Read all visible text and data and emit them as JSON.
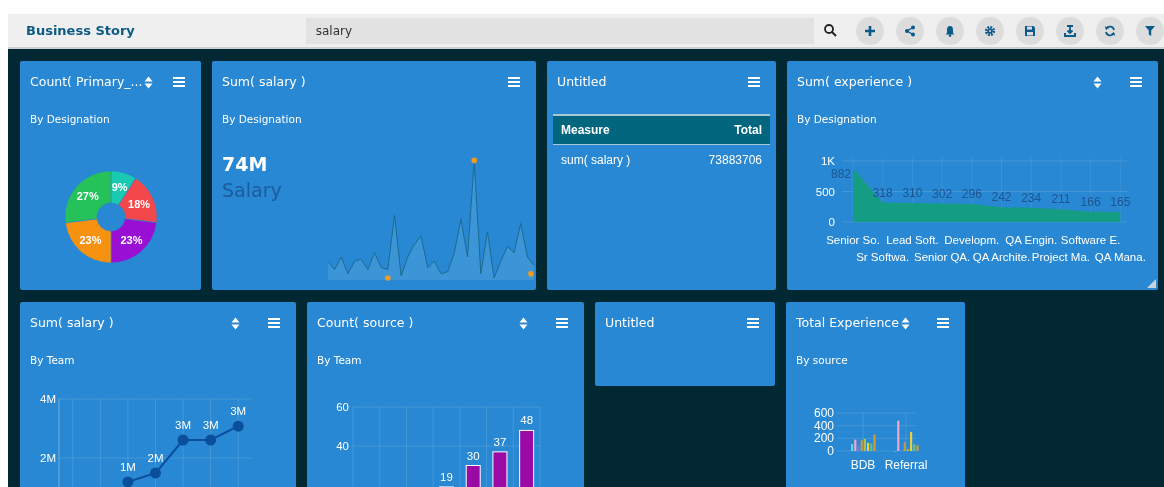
{
  "header": {
    "title": "Business Story",
    "search": {
      "value": "salary"
    }
  },
  "rows": [
    {
      "cards": [
        {
          "kind": "chart",
          "title": "Count( Primary_...",
          "sortable": true,
          "resize_handle": false,
          "subtitle": "By Designation",
          "chart_data": {
            "type": "donut",
            "values": [
              9,
              18,
              23,
              23,
              27
            ],
            "colors": [
              "#19c9b0",
              "#f2474b",
              "#9a0fd4",
              "#f6920f",
              "#25c25a"
            ],
            "value_labels": [
              "9%",
              "18%",
              "23%",
              "23%",
              "27%"
            ]
          }
        },
        {
          "kind": "kpi",
          "title": "Sum( salary )",
          "sortable": false,
          "resize_handle": false,
          "subtitle": "By Designation",
          "value": "74M",
          "label": "Salary"
        },
        {
          "kind": "table",
          "title": "Untitled",
          "sortable": false,
          "resize_handle": false,
          "table": {
            "columns": [
              "Measure",
              "Total"
            ],
            "rows": [
              [
                "sum( salary )",
                "73883706"
              ]
            ]
          }
        },
        {
          "kind": "chart",
          "title": "Sum( experience )",
          "sortable": true,
          "resize_handle": true,
          "subtitle": "By Designation",
          "chart_data": {
            "type": "area",
            "categories": [
              "Senior So.",
              "Sr Softwa.",
              "Lead Soft.",
              "Senior QA.",
              "Developm.",
              "QA Archite.",
              "QA Engin.",
              "Project Ma.",
              "Software E.",
              "QA Mana."
            ],
            "series": [
              {
                "color": "#159d83",
                "values": [
                  882,
                  318,
                  310,
                  302,
                  296,
                  242,
                  234,
                  211,
                  166,
                  165
                ]
              }
            ],
            "ylim": [
              0,
              1000
            ],
            "yticks": [
              {
                "value": 0,
                "label": "0"
              },
              {
                "value": 500,
                "label": "500"
              },
              {
                "value": 1000,
                "label": "1K"
              }
            ],
            "grid": true,
            "data_labels": true
          }
        }
      ]
    },
    {
      "cards": [
        {
          "kind": "chart",
          "title": "Sum( salary )",
          "sortable": true,
          "resize_handle": false,
          "subtitle": "By Team",
          "chart_data": {
            "type": "line",
            "categories": [
              null,
              null,
              null,
              null,
              null,
              null,
              null
            ],
            "series": [
              {
                "color": "#0b4f9c",
                "marker": "circle",
                "values": [
                  null,
                  null,
                  1190000,
                  1490000,
                  2610000,
                  2610000,
                  3080000
                ]
              }
            ],
            "ylim": [
              1000000,
              4000000
            ],
            "yticks": [
              {
                "value": 2000000,
                "label": "2M"
              },
              {
                "value": 4000000,
                "label": "4M"
              }
            ],
            "grid": true,
            "value_labels": [
              null,
              null,
              "1M",
              "2M",
              "3M",
              "3M",
              "3M"
            ]
          }
        },
        {
          "kind": "chart",
          "title": "Count( source )",
          "sortable": true,
          "resize_handle": false,
          "subtitle": "By Team",
          "chart_data": {
            "type": "bar",
            "categories": [
              null,
              null,
              null,
              null,
              null,
              null,
              null
            ],
            "series": [
              {
                "color": "#9c0aa6",
                "values": [
                  null,
                  null,
                  null,
                  19,
                  30,
                  37,
                  48
                ]
              }
            ],
            "ylim": [
              0,
              60
            ],
            "yticks": [
              40,
              60
            ],
            "grid": true,
            "data_labels": true
          }
        },
        {
          "kind": "empty",
          "title": "Untitled",
          "sortable": false,
          "resize_handle": false
        },
        {
          "kind": "chart",
          "title": "Total Experience",
          "sortable": true,
          "resize_handle": false,
          "subtitle": "By source",
          "chart_data": {
            "type": "bar",
            "categories": [
              "BDB",
              "Referral"
            ],
            "series": [
              {
                "color": "#5fd3e8",
                "values": [
                  110,
                  0
                ]
              },
              {
                "color": "#f0a6c8",
                "values": [
                  180,
                  480
                ]
              },
              {
                "color": "#6f7cf0",
                "values": [
                  90,
                  null
                ]
              },
              {
                "color": "#c49a48",
                "values": [
                  170,
                  140
                ]
              },
              {
                "color": "#b0c040",
                "values": [
                  190,
                  30
                ]
              },
              {
                "color": "#e8d040",
                "values": [
                  130,
                  300
                ]
              },
              {
                "color": "#60c090",
                "values": [
                  120,
                  110
                ]
              },
              {
                "color": "#d89a30",
                "values": [
                  260,
                  90
                ]
              }
            ],
            "ylim": [
              0,
              600
            ],
            "yticks": [
              0,
              200,
              400,
              600
            ],
            "grid": true
          }
        }
      ]
    }
  ]
}
